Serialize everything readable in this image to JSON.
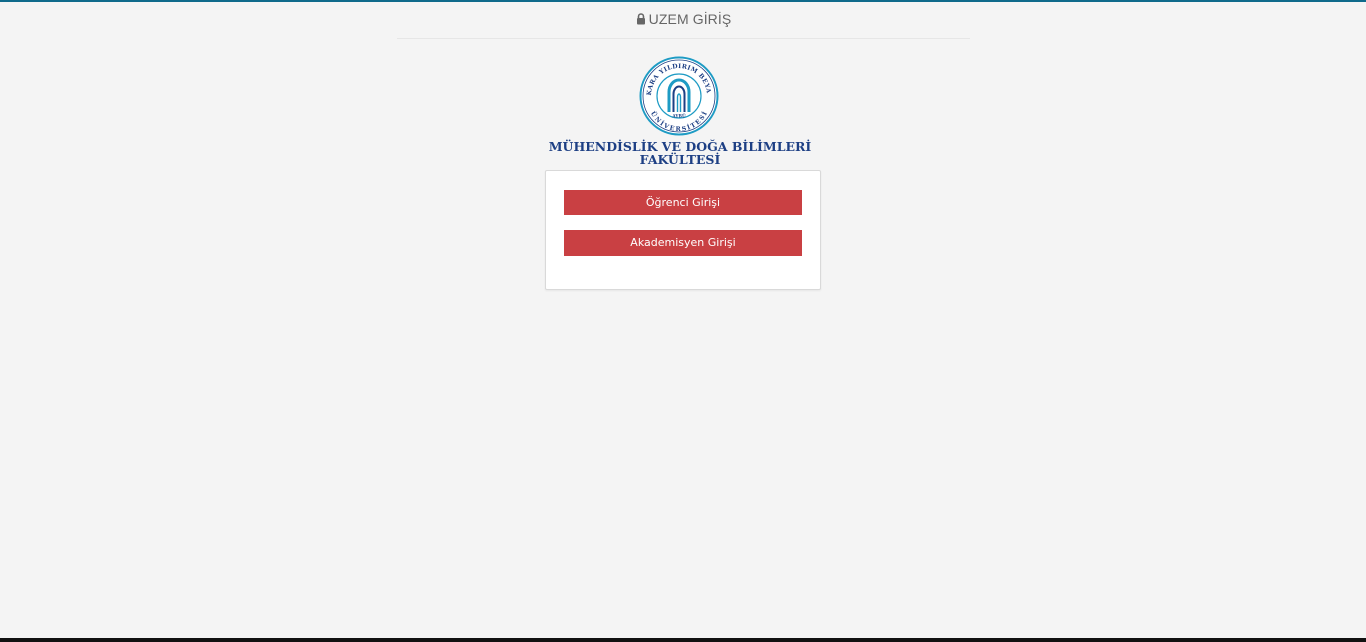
{
  "header": {
    "title": "UZEM GİRİŞ",
    "icon": "lock-icon"
  },
  "logo": {
    "ring_text_top": "ANKARA YILDIRIM BEYAZIT",
    "ring_text_bottom": "ÜNİVERSİTESİ",
    "center_text": "AYBÜ",
    "colors": {
      "ring": "#1e9bc4",
      "dark": "#1d3f84"
    }
  },
  "faculty": {
    "line1": "MÜHENDİSLİK VE DOĞA BİLİMLERİ",
    "line2": "FAKÜLTESİ"
  },
  "login": {
    "student_label": "Öğrenci Girişi",
    "academic_label": "Akademisyen Girişi"
  },
  "colors": {
    "button": "#c94043",
    "background": "#f4f4f4",
    "accent_bar": "#0f6a8b"
  }
}
